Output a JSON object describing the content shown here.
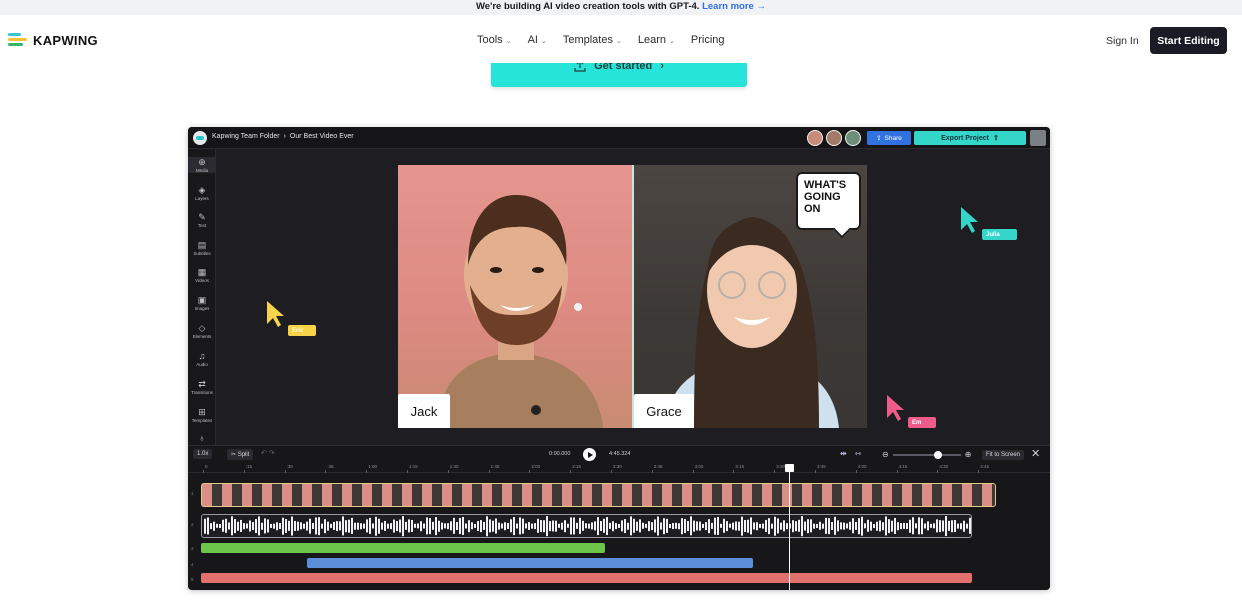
{
  "banner": {
    "text": "We're building AI video creation tools with GPT-4.",
    "link": "Learn more →"
  },
  "header": {
    "brand": "KAPWING",
    "nav": [
      "Tools",
      "AI",
      "Templates",
      "Learn",
      "Pricing"
    ],
    "sign_in": "Sign In",
    "cta": "Start Editing"
  },
  "hero": {
    "get_started": "Get started",
    "get_started_icons": [
      "upload-icon",
      "chevron-right-icon"
    ]
  },
  "editor": {
    "breadcrumb": [
      "Kapwing Team Folder",
      "›",
      "Our Best Video Ever"
    ],
    "share": "Share",
    "export": "Export Project",
    "sidebar": [
      "Media",
      "Layers",
      "Text",
      "Subtitles",
      "Videos",
      "Images",
      "Elements",
      "Audio",
      "Transitions",
      "Templates"
    ],
    "sidebar_icons": [
      "plus-icon",
      "layers-icon",
      "text-icon",
      "subtitles-icon",
      "video-icon",
      "image-icon",
      "shapes-icon",
      "music-icon",
      "transitions-icon",
      "grid-icon"
    ],
    "canvas": {
      "left_name": "Jack",
      "right_name": "Grace",
      "speech_bubble": [
        "WHAT'S",
        "GOING",
        "ON"
      ]
    },
    "cursors": [
      {
        "name": "Eric",
        "color": "#f5d44a"
      },
      {
        "name": "Julia",
        "color": "#33d6c9"
      },
      {
        "name": "Em",
        "color": "#ef5c8a"
      }
    ],
    "timeline": {
      "speed": "1.0x",
      "split": "Split",
      "current_time": "0:00.000",
      "total_time": "4:45.324",
      "fit": "Fit to Screen",
      "ticks": [
        "0",
        ":15",
        ":30",
        ":45",
        "1:00",
        "1:15",
        "1:30",
        "1:45",
        "2:00",
        "2:15",
        "2:30",
        "2:45",
        "3:00",
        "3:15",
        "3:30",
        "3:45",
        "4:00",
        "4:15",
        "4:30",
        "4:45"
      ],
      "track_numbers": [
        "1",
        "2",
        "3",
        "4",
        "5"
      ]
    }
  },
  "colors": {
    "accent_teal": "#27e4d8",
    "dark_button": "#1b1b25",
    "share_blue": "#3272e0",
    "track_green": "#6cc44a",
    "track_blue": "#5b8fd9",
    "track_red": "#e2706c"
  }
}
